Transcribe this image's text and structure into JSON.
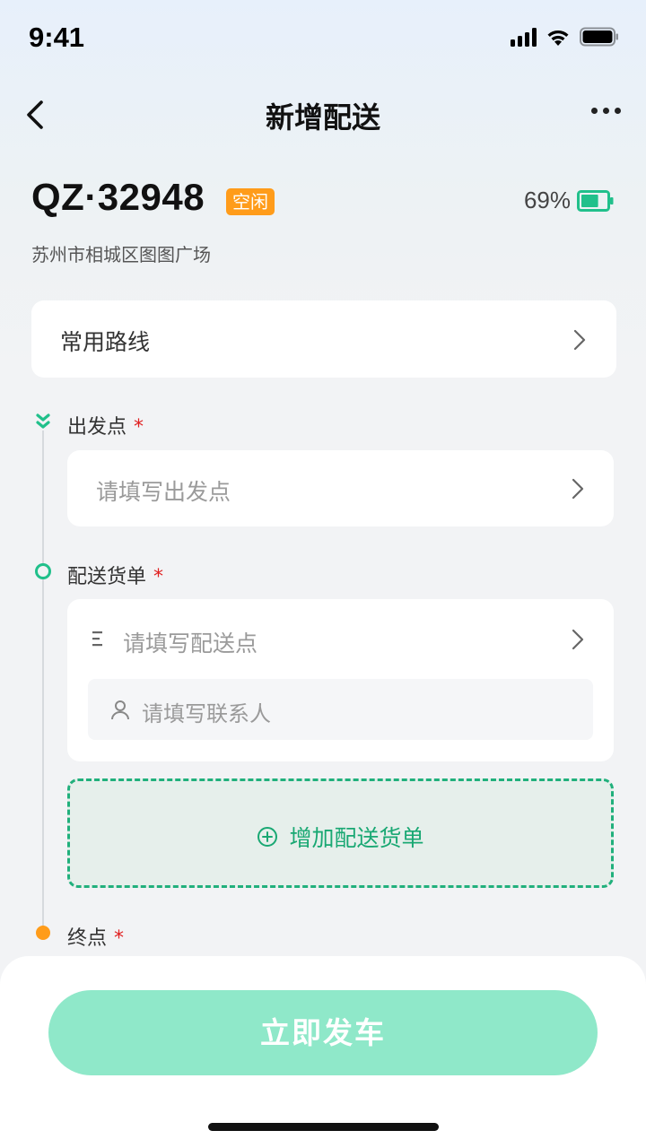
{
  "status_bar": {
    "time": "9:41",
    "icons": [
      "signal-icon",
      "wifi-icon",
      "battery-icon"
    ]
  },
  "nav": {
    "title": "新增配送",
    "back_icon": "chevron-left-icon",
    "more_icon": "more-icon"
  },
  "vehicle": {
    "plate": "QZ·32948",
    "status": "空闲",
    "battery": "69%",
    "battery_level": 0.69,
    "address": "苏州市相城区图图广场"
  },
  "route": {
    "label": "常用路线"
  },
  "origin": {
    "label": "出发点",
    "required_mark": "*",
    "placeholder": "请填写出发点"
  },
  "delivery": {
    "label": "配送货单",
    "required_mark": "*",
    "stop_placeholder": "请填写配送点",
    "contact_placeholder": "请填写联系人",
    "add_label": "增加配送货单"
  },
  "destination": {
    "label": "终点",
    "required_mark": "*"
  },
  "actions": {
    "depart_label": "立即发车"
  },
  "colors": {
    "accent": "#21C08B",
    "warning": "#FF9C1A",
    "required": "#E02020",
    "button_disabled": "#8FE8C9"
  }
}
